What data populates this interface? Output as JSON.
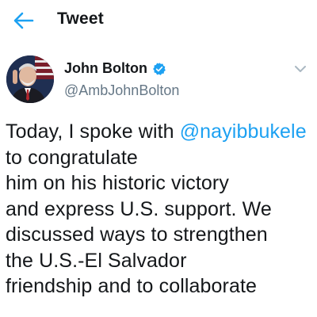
{
  "header": {
    "title": "Tweet",
    "back_icon": "arrow-left-icon"
  },
  "tweet": {
    "author_name": "John Bolton",
    "author_handle": "@AmbJohnBolton",
    "verified_icon": "verified-badge-icon",
    "menu_icon": "chevron-down-icon",
    "text_before_mention": "Today, I spoke with",
    "mention": "@nayibbukele",
    "text_after_mention": " to congratulate\nhim on his historic victory\nand express U.S. support. We\ndiscussed ways to strengthen\nthe U.S.-El Salvador\nfriendship and to collaborate"
  },
  "colors": {
    "accent": "#1da1f2",
    "text": "#14171a",
    "secondary_text": "#657786"
  }
}
